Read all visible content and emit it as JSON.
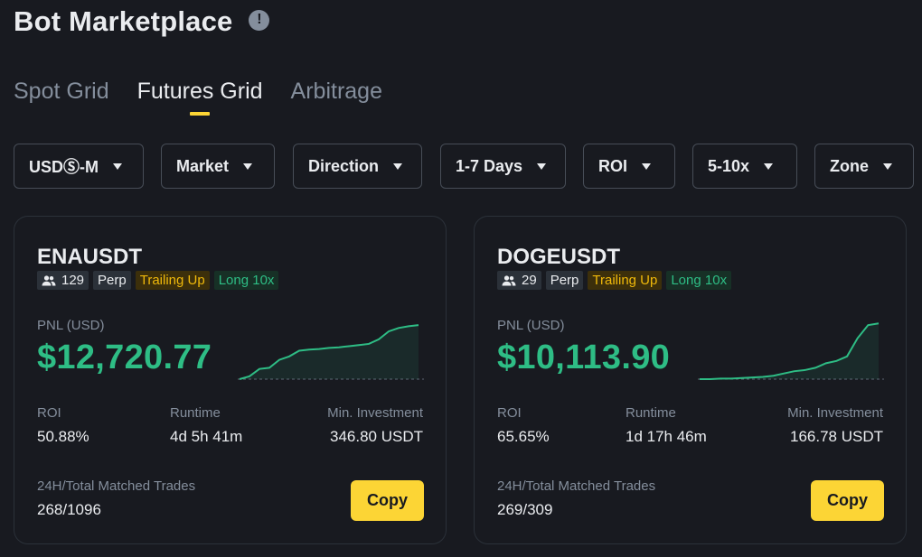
{
  "header": {
    "title": "Bot Marketplace",
    "info_icon": "!"
  },
  "tabs": [
    {
      "label": "Spot Grid",
      "active": false
    },
    {
      "label": "Futures Grid",
      "active": true
    },
    {
      "label": "Arbitrage",
      "active": false
    }
  ],
  "filters": [
    {
      "label": "USDⓈ-M"
    },
    {
      "label": "Market"
    },
    {
      "label": "Direction"
    },
    {
      "label": "1-7 Days"
    },
    {
      "label": "ROI"
    },
    {
      "label": "5-10x"
    },
    {
      "label": "Zone"
    }
  ],
  "cards": [
    {
      "pair": "ENAUSDT",
      "users": "129",
      "tags": [
        "Perp",
        "Trailing Up",
        "Long 10x"
      ],
      "pnl_label": "PNL (USD)",
      "pnl_value": "$12,720.77",
      "sparkline": [
        0.0,
        0.05,
        0.18,
        0.2,
        0.34,
        0.4,
        0.5,
        0.52,
        0.53,
        0.55,
        0.56,
        0.58,
        0.6,
        0.62,
        0.7,
        0.84,
        0.9,
        0.93,
        0.95
      ],
      "roi_label": "ROI",
      "roi_value": "50.88%",
      "runtime_label": "Runtime",
      "runtime_value": "4d 5h 41m",
      "min_invest_label": "Min. Investment",
      "min_invest_value": "346.80 USDT",
      "trades_label": "24H/Total Matched Trades",
      "trades_value": "268/1096",
      "copy_label": "Copy"
    },
    {
      "pair": "DOGEUSDT",
      "users": "29",
      "tags": [
        "Perp",
        "Trailing Up",
        "Long 10x"
      ],
      "pnl_label": "PNL (USD)",
      "pnl_value": "$10,113.90",
      "sparkline": [
        0.0,
        0.0,
        0.01,
        0.01,
        0.02,
        0.03,
        0.04,
        0.06,
        0.1,
        0.14,
        0.16,
        0.2,
        0.28,
        0.32,
        0.4,
        0.72,
        0.95,
        0.98
      ],
      "roi_label": "ROI",
      "roi_value": "65.65%",
      "runtime_label": "Runtime",
      "runtime_value": "1d 17h 46m",
      "min_invest_label": "Min. Investment",
      "min_invest_value": "166.78 USDT",
      "trades_label": "24H/Total Matched Trades",
      "trades_value": "269/309",
      "copy_label": "Copy"
    }
  ],
  "colors": {
    "background": "#181a20",
    "accent": "#fcd535",
    "positive": "#2ebd85",
    "muted": "#848e9c"
  }
}
